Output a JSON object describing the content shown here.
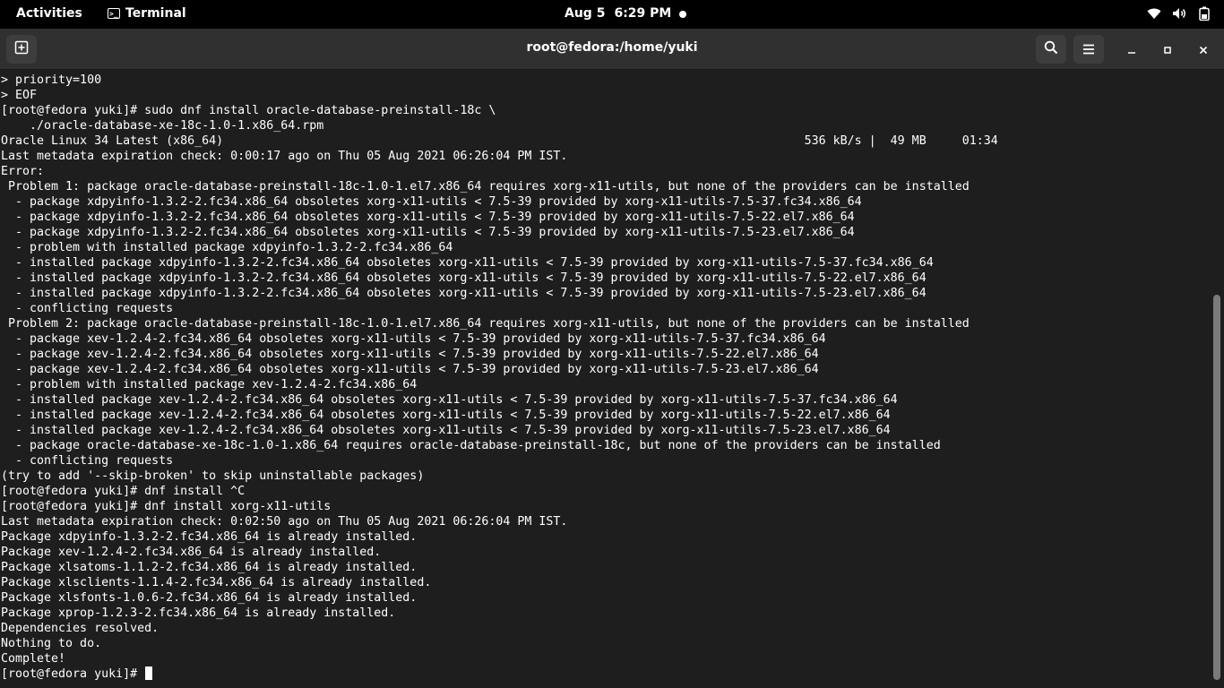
{
  "topbar": {
    "activities": "Activities",
    "app_name": "Terminal",
    "date": "Aug 5",
    "time": "6:29 PM"
  },
  "window": {
    "title": "root@fedora:/home/yuki"
  },
  "icons": {
    "new_tab": "new-tab-icon",
    "search": "search-icon",
    "menu": "hamburger-menu-icon",
    "minimize": "minimize-icon",
    "maximize": "maximize-icon",
    "close": "close-icon",
    "wifi": "wifi-icon",
    "volume": "volume-icon",
    "battery": "battery-icon"
  },
  "colors": {
    "terminal_bg": "#1e1e1e",
    "headerbar_bg": "#303030",
    "topbar_bg": "#000000"
  },
  "terminal": {
    "lines": [
      "> priority=100",
      "> EOF",
      "[root@fedora yuki]# sudo dnf install oracle-database-preinstall-18c \\",
      "    ./oracle-database-xe-18c-1.0-1.x86_64.rpm",
      "Oracle Linux 34 Latest (x86_64)                                                                                 536 kB/s |  49 MB     01:34",
      "Last metadata expiration check: 0:00:17 ago on Thu 05 Aug 2021 06:26:04 PM IST.",
      "Error:",
      " Problem 1: package oracle-database-preinstall-18c-1.0-1.el7.x86_64 requires xorg-x11-utils, but none of the providers can be installed",
      "  - package xdpyinfo-1.3.2-2.fc34.x86_64 obsoletes xorg-x11-utils < 7.5-39 provided by xorg-x11-utils-7.5-37.fc34.x86_64",
      "  - package xdpyinfo-1.3.2-2.fc34.x86_64 obsoletes xorg-x11-utils < 7.5-39 provided by xorg-x11-utils-7.5-22.el7.x86_64",
      "  - package xdpyinfo-1.3.2-2.fc34.x86_64 obsoletes xorg-x11-utils < 7.5-39 provided by xorg-x11-utils-7.5-23.el7.x86_64",
      "  - problem with installed package xdpyinfo-1.3.2-2.fc34.x86_64",
      "  - installed package xdpyinfo-1.3.2-2.fc34.x86_64 obsoletes xorg-x11-utils < 7.5-39 provided by xorg-x11-utils-7.5-37.fc34.x86_64",
      "  - installed package xdpyinfo-1.3.2-2.fc34.x86_64 obsoletes xorg-x11-utils < 7.5-39 provided by xorg-x11-utils-7.5-22.el7.x86_64",
      "  - installed package xdpyinfo-1.3.2-2.fc34.x86_64 obsoletes xorg-x11-utils < 7.5-39 provided by xorg-x11-utils-7.5-23.el7.x86_64",
      "  - conflicting requests",
      " Problem 2: package oracle-database-preinstall-18c-1.0-1.el7.x86_64 requires xorg-x11-utils, but none of the providers can be installed",
      "  - package xev-1.2.4-2.fc34.x86_64 obsoletes xorg-x11-utils < 7.5-39 provided by xorg-x11-utils-7.5-37.fc34.x86_64",
      "  - package xev-1.2.4-2.fc34.x86_64 obsoletes xorg-x11-utils < 7.5-39 provided by xorg-x11-utils-7.5-22.el7.x86_64",
      "  - package xev-1.2.4-2.fc34.x86_64 obsoletes xorg-x11-utils < 7.5-39 provided by xorg-x11-utils-7.5-23.el7.x86_64",
      "  - problem with installed package xev-1.2.4-2.fc34.x86_64",
      "  - installed package xev-1.2.4-2.fc34.x86_64 obsoletes xorg-x11-utils < 7.5-39 provided by xorg-x11-utils-7.5-37.fc34.x86_64",
      "  - installed package xev-1.2.4-2.fc34.x86_64 obsoletes xorg-x11-utils < 7.5-39 provided by xorg-x11-utils-7.5-22.el7.x86_64",
      "  - installed package xev-1.2.4-2.fc34.x86_64 obsoletes xorg-x11-utils < 7.5-39 provided by xorg-x11-utils-7.5-23.el7.x86_64",
      "  - package oracle-database-xe-18c-1.0-1.x86_64 requires oracle-database-preinstall-18c, but none of the providers can be installed",
      "  - conflicting requests",
      "(try to add '--skip-broken' to skip uninstallable packages)",
      "[root@fedora yuki]# dnf install ^C",
      "[root@fedora yuki]# dnf install xorg-x11-utils",
      "Last metadata expiration check: 0:02:50 ago on Thu 05 Aug 2021 06:26:04 PM IST.",
      "Package xdpyinfo-1.3.2-2.fc34.x86_64 is already installed.",
      "Package xev-1.2.4-2.fc34.x86_64 is already installed.",
      "Package xlsatoms-1.1.2-2.fc34.x86_64 is already installed.",
      "Package xlsclients-1.1.4-2.fc34.x86_64 is already installed.",
      "Package xlsfonts-1.0.6-2.fc34.x86_64 is already installed.",
      "Package xprop-1.2.3-2.fc34.x86_64 is already installed.",
      "Dependencies resolved.",
      "Nothing to do.",
      "Complete!"
    ],
    "prompt": "[root@fedora yuki]# "
  }
}
